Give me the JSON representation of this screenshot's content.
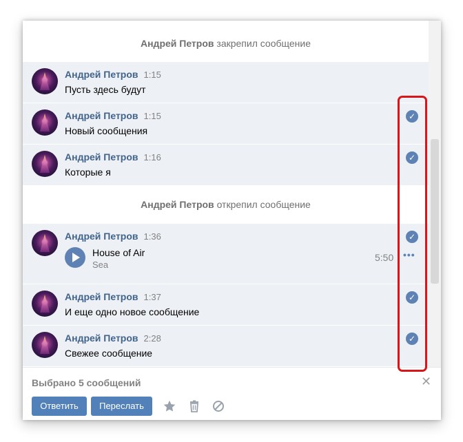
{
  "dialog": {
    "service_messages": [
      {
        "actor": "Андрей Петров",
        "action": "закрепил сообщение"
      },
      {
        "actor": "Андрей Петров",
        "action": "открепил сообщение"
      }
    ],
    "messages": [
      {
        "author": "Андрей Петров",
        "time": "1:15",
        "text": "Пусть здесь будут",
        "selected": false
      },
      {
        "author": "Андрей Петров",
        "time": "1:15",
        "text": "Новый сообщения",
        "selected": true
      },
      {
        "author": "Андрей Петров",
        "time": "1:16",
        "text": "Которые я",
        "selected": true
      },
      {
        "author": "Андрей Петров",
        "time": "1:36",
        "text": "",
        "selected": true,
        "audio": {
          "title": "House of Air",
          "artist": "Sea",
          "duration": "5:50",
          "more": "•••"
        }
      },
      {
        "author": "Андрей Петров",
        "time": "1:37",
        "text": "И еще одно новое сообщение",
        "selected": true
      },
      {
        "author": "Андрей Петров",
        "time": "2:28",
        "text": "Свежее сообщение",
        "selected": true
      }
    ],
    "check_glyph": "✓"
  },
  "footer": {
    "selected_label": "Выбрано 5 сообщений",
    "close_glyph": "✕",
    "reply_label": "Ответить",
    "forward_label": "Переслать",
    "icons": [
      "star-icon",
      "trash-icon",
      "block-icon"
    ]
  },
  "colors": {
    "accent": "#5181b8",
    "author": "#42648b",
    "message_bg": "#edf0f5",
    "highlight": "#d6161a"
  }
}
